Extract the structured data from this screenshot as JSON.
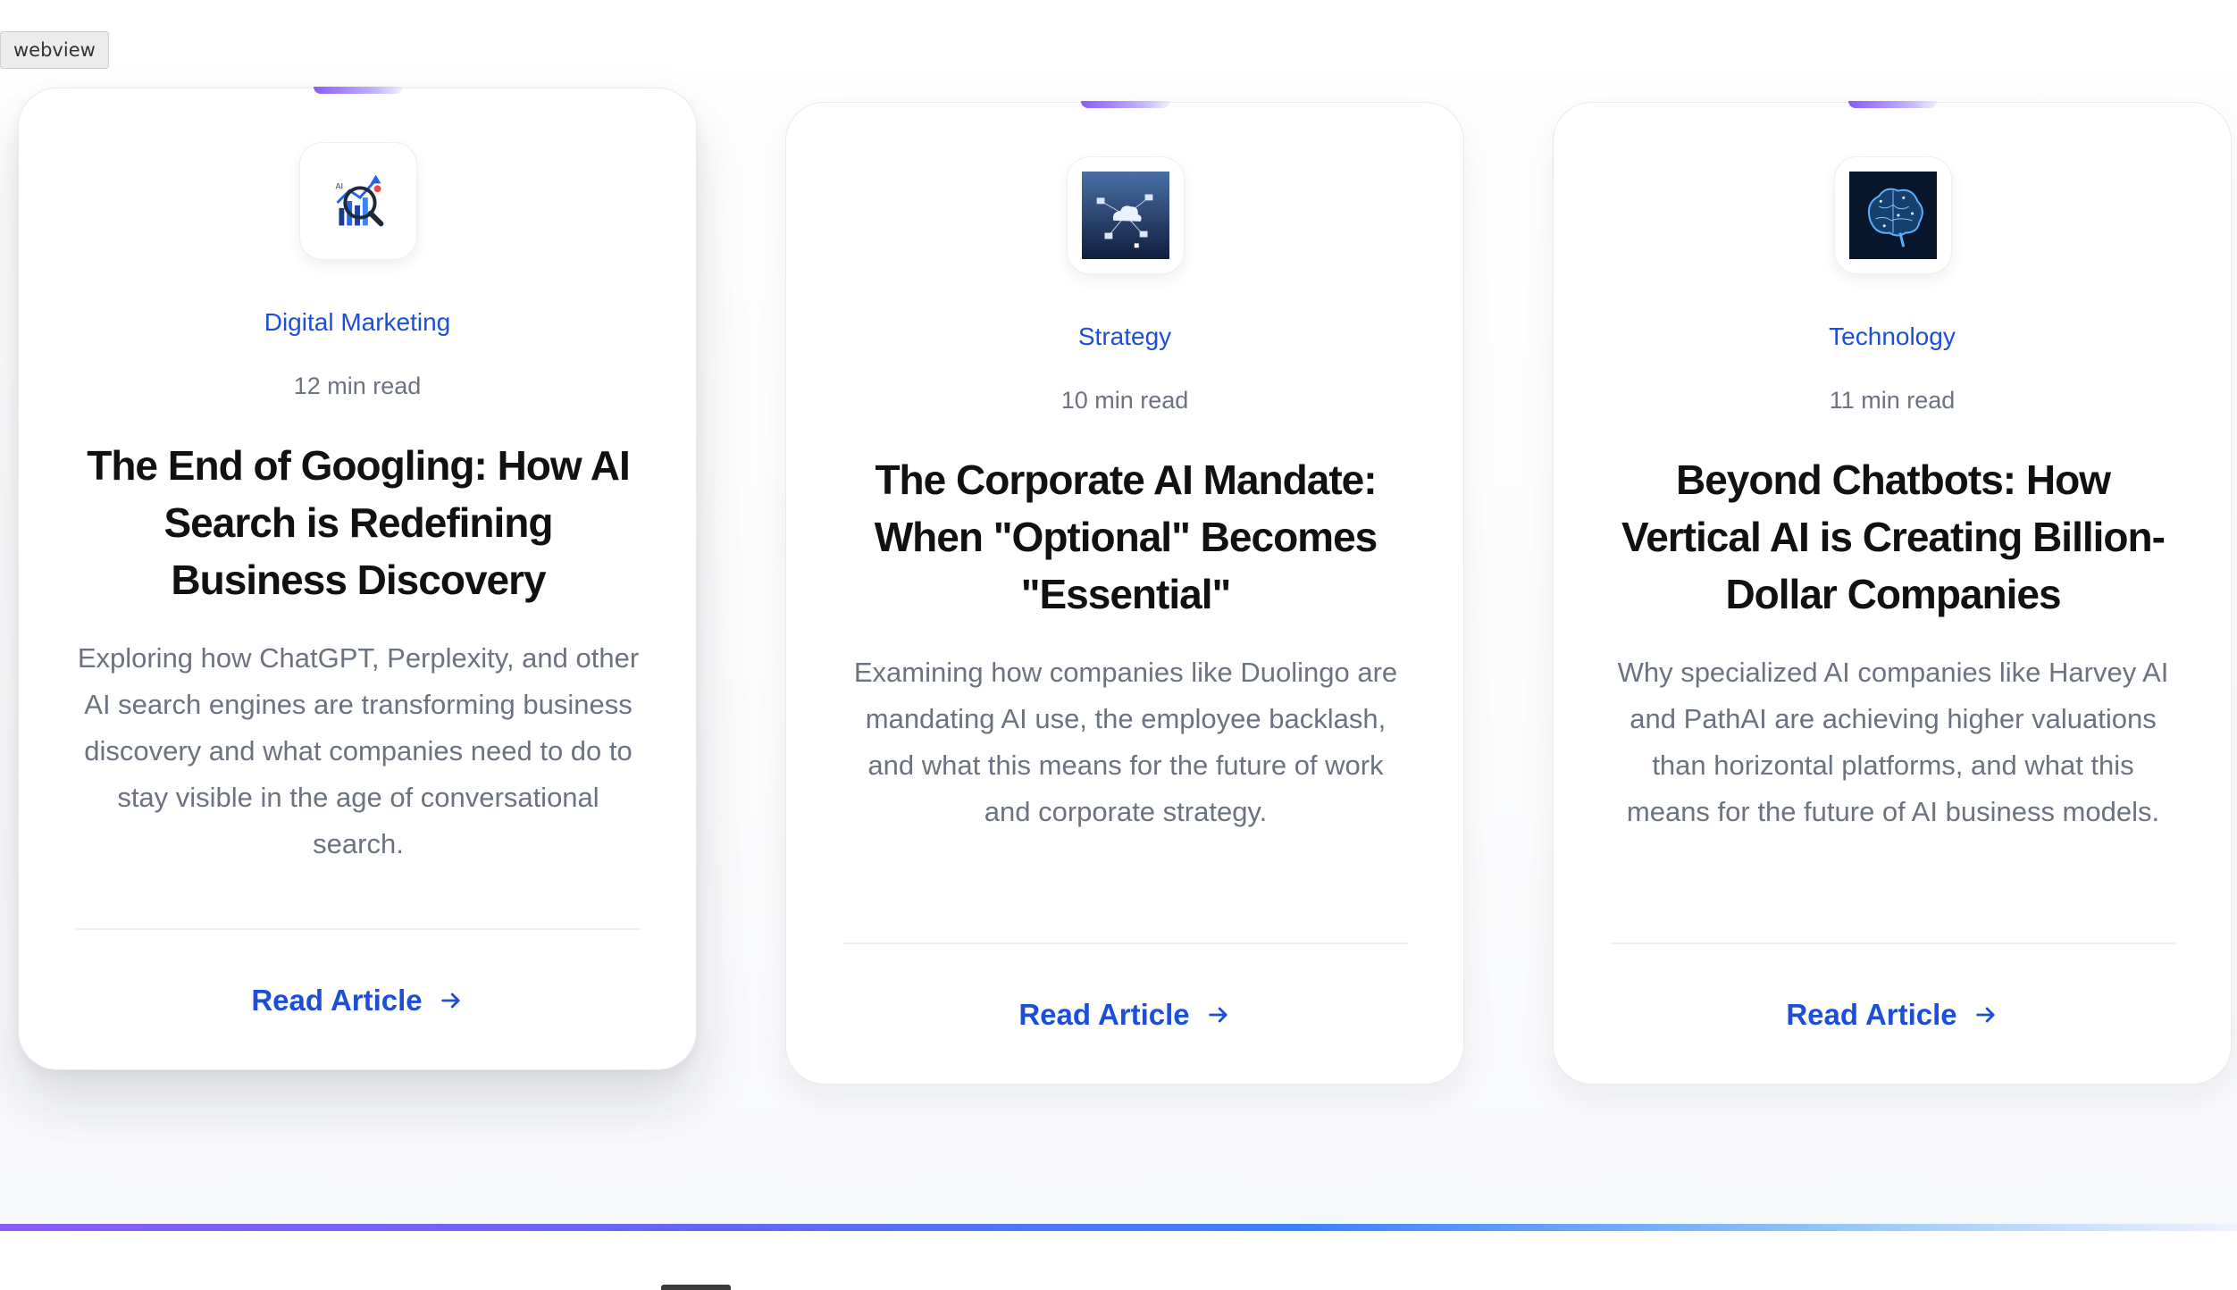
{
  "webview_tag": "webview",
  "colors": {
    "accent_blue": "#1d4ed8",
    "accent_purple": "#8b5cf6",
    "title_text": "#111111",
    "muted_text": "#6b7280"
  },
  "cards": [
    {
      "category": "Digital Marketing",
      "read_time": "12 min read",
      "title": "The End of Googling: How AI Search is Redefining Business Discovery",
      "description": "Exploring how ChatGPT, Perplexity, and other AI search engines are transforming business discovery and what companies need to do to stay visible in the age of conversational search.",
      "link_label": "Read Article",
      "thumbnail": "ai-search-analytics-icon",
      "hovered": true
    },
    {
      "category": "Strategy",
      "read_time": "10 min read",
      "title": "The Corporate AI Mandate: When \"Optional\" Becomes \"Essential\"",
      "description": "Examining how companies like Duolingo are mandating AI use, the employee backlash, and what this means for the future of work and corporate strategy.",
      "link_label": "Read Article",
      "thumbnail": "cloud-network-image",
      "hovered": false
    },
    {
      "category": "Technology",
      "read_time": "11 min read",
      "title": "Beyond Chatbots: How Vertical AI is Creating Billion-Dollar Companies",
      "description": "Why specialized AI companies like Harvey AI and PathAI are achieving higher valuations than horizontal platforms, and what this means for the future of AI business models.",
      "link_label": "Read Article",
      "thumbnail": "digital-brain-image",
      "hovered": false
    }
  ]
}
